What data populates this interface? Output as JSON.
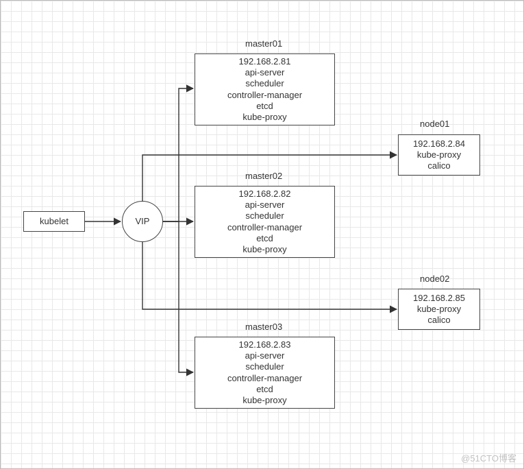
{
  "watermark": "@51CTO博客",
  "kubelet": {
    "label": "kubelet"
  },
  "vip": {
    "label": "VIP"
  },
  "master01": {
    "title": "master01",
    "ip": "192.168.2.81",
    "lines": [
      "api-server",
      "scheduler",
      "controller-manager",
      "etcd",
      "kube-proxy"
    ]
  },
  "master02": {
    "title": "master02",
    "ip": "192.168.2.82",
    "lines": [
      "api-server",
      "scheduler",
      "controller-manager",
      "etcd",
      "kube-proxy"
    ]
  },
  "master03": {
    "title": "master03",
    "ip": "192.168.2.83",
    "lines": [
      "api-server",
      "scheduler",
      "controller-manager",
      "etcd",
      "kube-proxy"
    ]
  },
  "node01": {
    "title": "node01",
    "ip": "192.168.2.84",
    "lines": [
      "kube-proxy",
      "calico"
    ]
  },
  "node02": {
    "title": "node02",
    "ip": "192.168.2.85",
    "lines": [
      "kube-proxy",
      "calico"
    ]
  }
}
